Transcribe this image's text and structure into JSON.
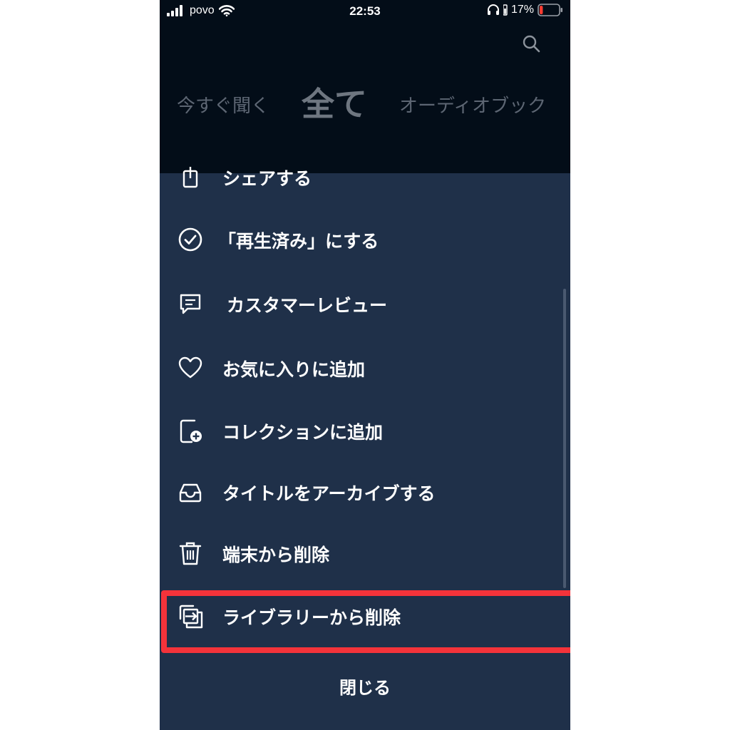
{
  "status_bar": {
    "carrier": "povo",
    "time": "22:53",
    "battery_percent": "17%",
    "battery_level": 0.17,
    "battery_color": "#ff3b30"
  },
  "header": {
    "search_icon": "search-icon",
    "tabs": [
      {
        "label": "今すぐ聞く"
      },
      {
        "label": "全て"
      },
      {
        "label": "オーディオブック"
      }
    ]
  },
  "menu": {
    "items": [
      {
        "label": "シェアする",
        "icon": "share-icon"
      },
      {
        "label": "「再生済み」にする",
        "icon": "check-circle-icon"
      },
      {
        "label": "カスタマーレビュー",
        "icon": "chat-bubble-icon"
      },
      {
        "label": "お気に入りに追加",
        "icon": "heart-icon"
      },
      {
        "label": "コレクションに追加",
        "icon": "collection-add-icon"
      },
      {
        "label": "タイトルをアーカイブする",
        "icon": "archive-tray-icon"
      },
      {
        "label": "端末から削除",
        "icon": "trash-icon"
      },
      {
        "label": "ライブラリーから削除",
        "icon": "library-remove-icon"
      }
    ],
    "close_label": "閉じる"
  },
  "colors": {
    "sheet_background": "#1f3049",
    "header_background": "#030d18",
    "highlight": "#f4333a"
  }
}
